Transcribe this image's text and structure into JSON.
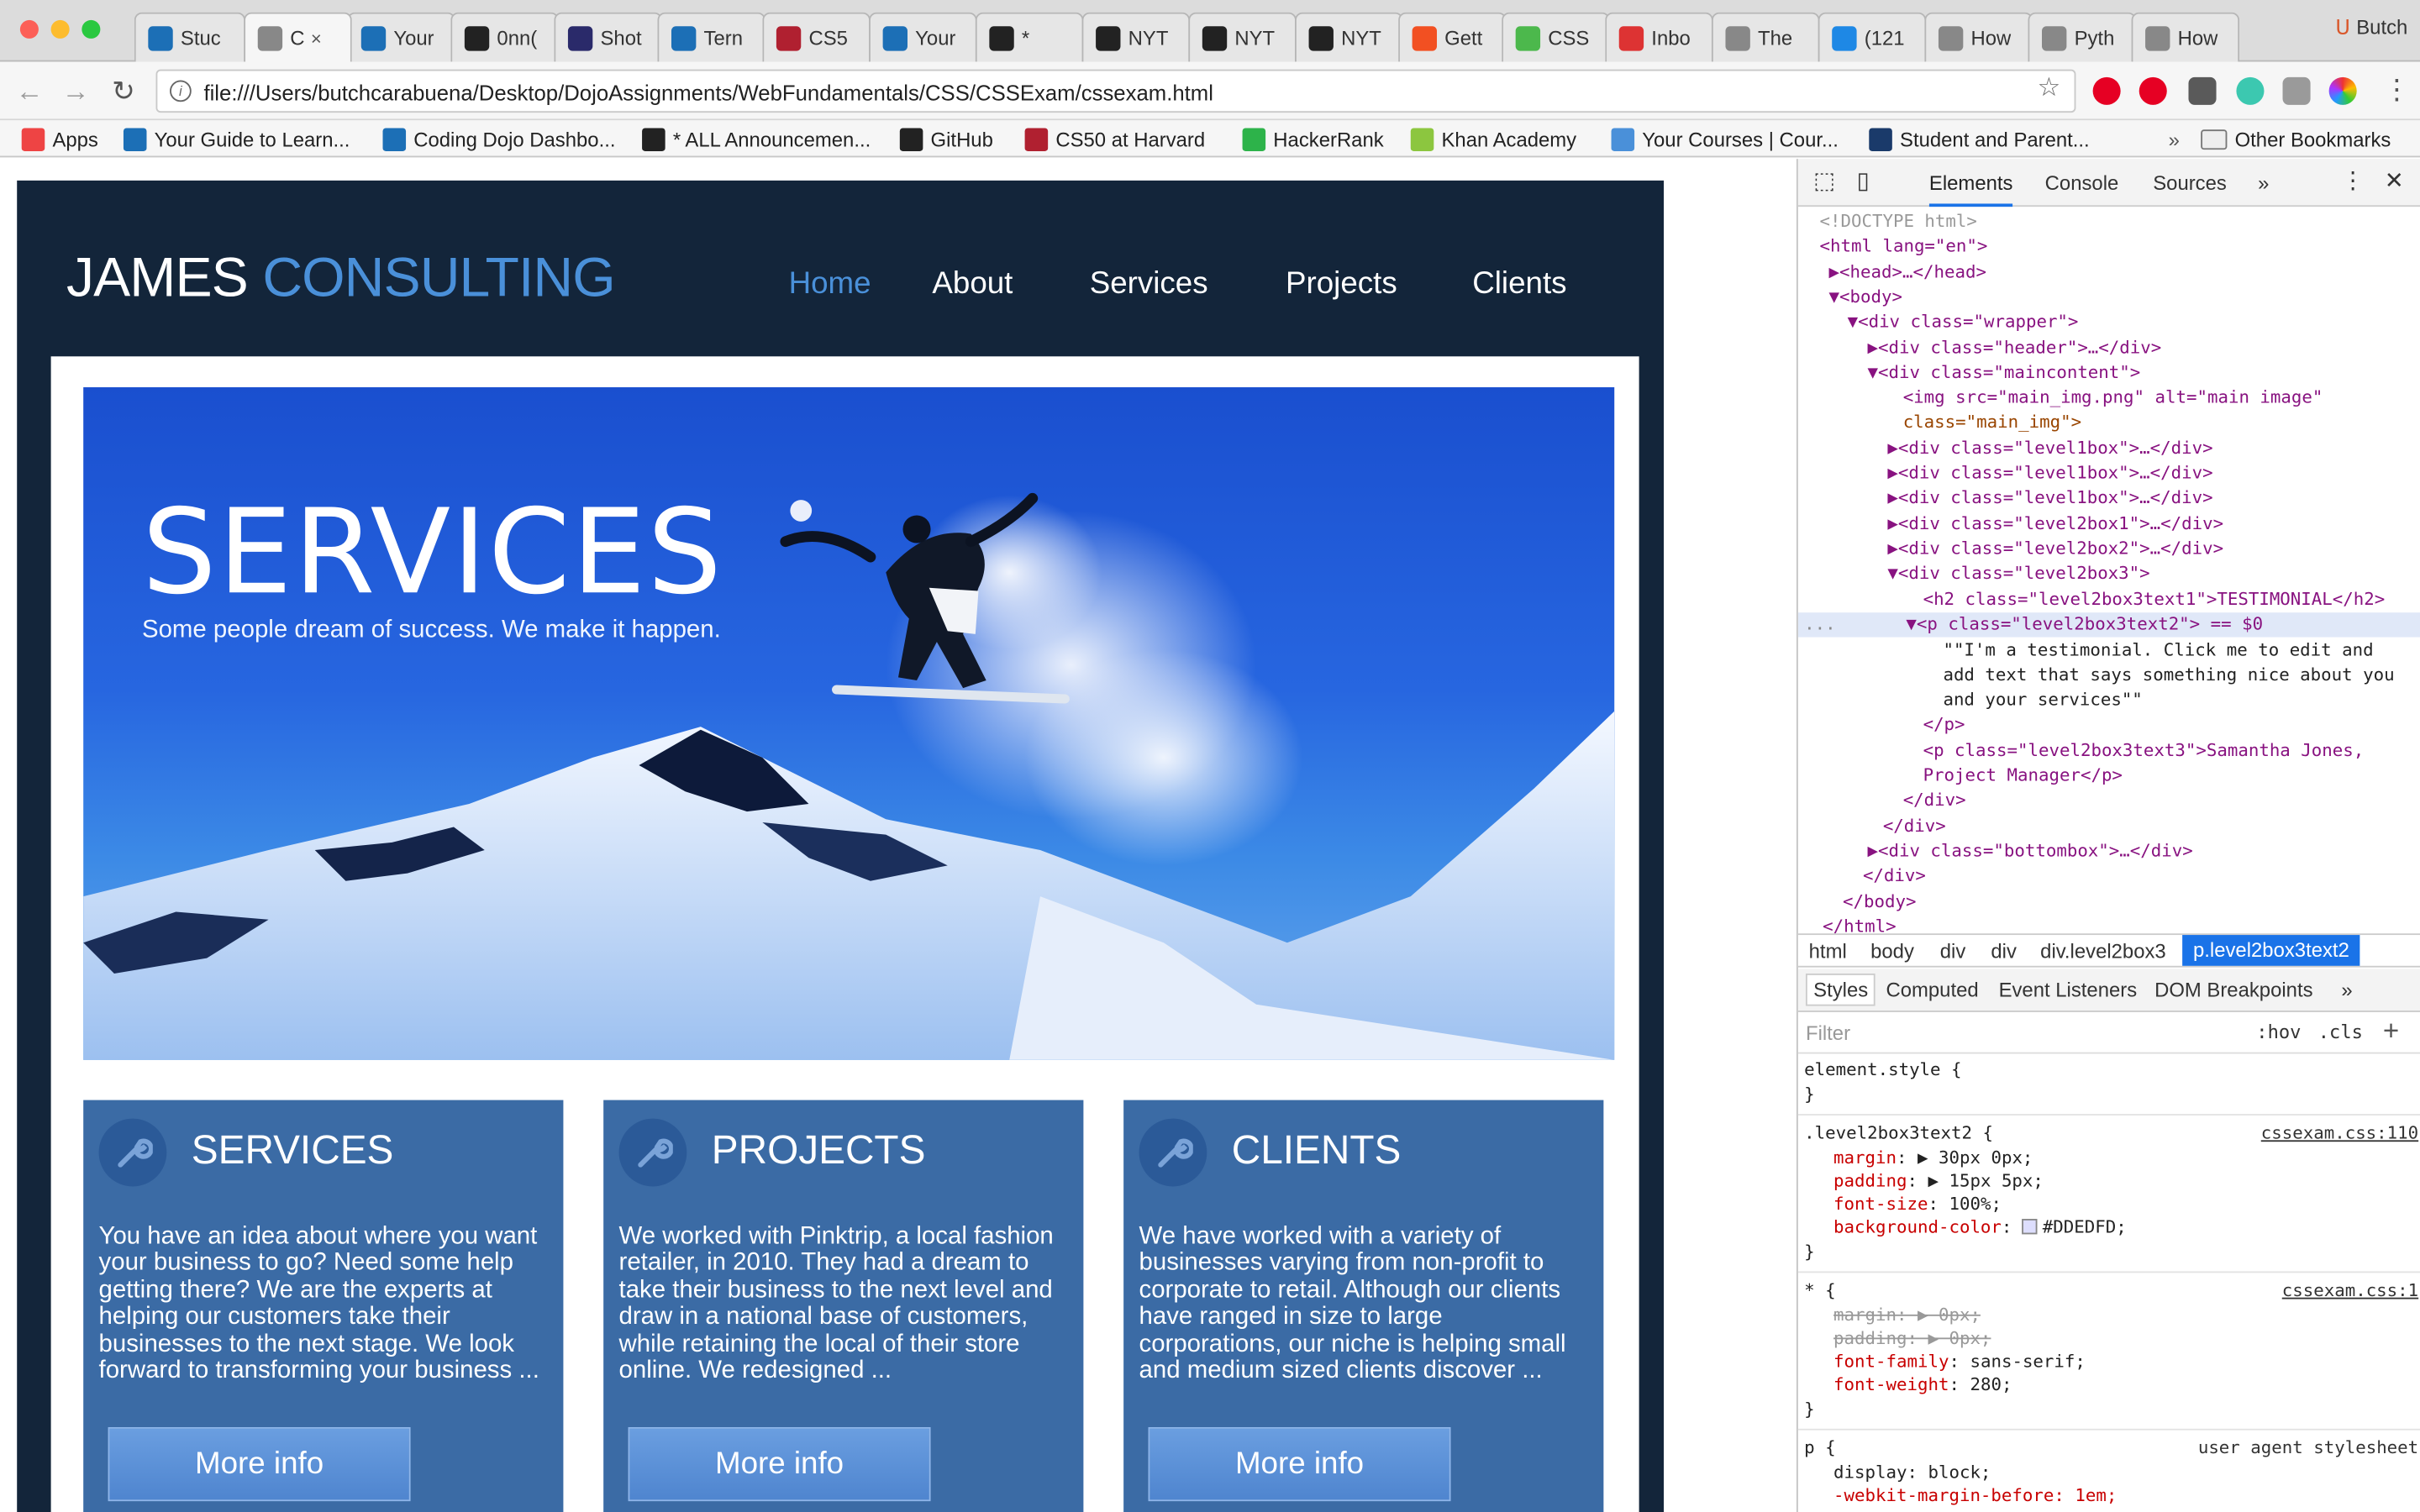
{
  "browser": {
    "tabs": [
      {
        "label": "Stuc"
      },
      {
        "label": "C"
      },
      {
        "label": "Your"
      },
      {
        "label": "0nn("
      },
      {
        "label": "Shot"
      },
      {
        "label": "Tern"
      },
      {
        "label": "CS5"
      },
      {
        "label": "Your"
      },
      {
        "label": "*"
      },
      {
        "label": "NYT"
      },
      {
        "label": "NYT"
      },
      {
        "label": "NYT"
      },
      {
        "label": "Gett"
      },
      {
        "label": "CSS"
      },
      {
        "label": "Inbo"
      },
      {
        "label": "The"
      },
      {
        "label": "(121"
      },
      {
        "label": "How"
      },
      {
        "label": "Pyth"
      },
      {
        "label": "How"
      }
    ],
    "close_glyph": "×",
    "profile_name": "Butch",
    "url": "file:///Users/butchcarabuena/Desktop/DojoAssignments/WebFundamentals/CSS/CSSExam/cssexam.html",
    "bookmarks": [
      {
        "label": "Apps"
      },
      {
        "label": "Your Guide to Learn..."
      },
      {
        "label": "Coding Dojo Dashbo..."
      },
      {
        "label": "* ALL Announcemen..."
      },
      {
        "label": "GitHub"
      },
      {
        "label": "CS50 at Harvard"
      },
      {
        "label": "HackerRank"
      },
      {
        "label": "Khan Academy"
      },
      {
        "label": "Your Courses | Cour..."
      },
      {
        "label": "Student and Parent..."
      }
    ],
    "bookmarks_more": "»",
    "other_bookmarks": "Other Bookmarks"
  },
  "site": {
    "logo_first": "JAMES",
    "logo_second": "CONSULTING",
    "nav": [
      "Home",
      "About",
      "Services",
      "Projects",
      "Clients"
    ],
    "hero_title": "SERVICES",
    "hero_subtitle": "Some people dream of success. We make it happen.",
    "cards": [
      {
        "title": "SERVICES",
        "text": "You have an idea about where you want your business to go? Need some help getting there? We are the experts at helping our customers take their businesses to the next stage. We look forward to transforming your business ...",
        "button": "More info"
      },
      {
        "title": "PROJECTS",
        "text": "We worked with Pinktrip, a local fashion retailer, in 2010. They had a dream to take their business to the next level and draw in a national base of customers, while retaining the local of their store online. We redesigned ...",
        "button": "More info"
      },
      {
        "title": "CLIENTS",
        "text": "We have worked with a variety of businesses varying from non-profit to corporate to retail. Although our clients have ranged in size to large corporations, our niche is helping small and medium sized clients discover ...",
        "button": "More info"
      }
    ]
  },
  "devtools": {
    "tabs": [
      "Elements",
      "Console",
      "Sources"
    ],
    "more_tabs": "»",
    "dom": {
      "doctype": "<!DOCTYPE html>",
      "html_open": "<html lang=\"en\">",
      "head": "<head>…</head>",
      "body_open": "<body>",
      "wrapper": "<div class=\"wrapper\">",
      "header": "<div class=\"header\">…</div>",
      "maincontent": "<div class=\"maincontent\">",
      "img_line1": "<img src=\"main_img.png\" alt=\"main image\"",
      "img_line2": "class=\"main_img\">",
      "level1box_a": "<div class=\"level1box\">…</div>",
      "level1box_b": "<div class=\"level1box\">…</div>",
      "level1box_c": "<div class=\"level1box\">…</div>",
      "level2box1": "<div class=\"level2box1\">…</div>",
      "level2box2": "<div class=\"level2box2\">…</div>",
      "level2box3": "<div class=\"level2box3\">",
      "h2_line": "<h2 class=\"level2box3text1\">TESTIMONIAL</h2>",
      "p_selected": "<p class=\"level2box3text2\"> == $0",
      "ellipsis": "...",
      "text_line1": "\"\"I'm a testimonial. Click me to edit and",
      "text_line2": "add text that says something nice about you",
      "text_line3": "and your services\"\"",
      "p_close": "</p>",
      "p3_line1": "<p class=\"level2box3text3\">Samantha Jones,",
      "p3_line2": "Project Manager</p>",
      "div_close_1": "</div>",
      "div_close_2": "</div>",
      "bottombox": "<div class=\"bottombox\">…</div>",
      "div_close_3": "</div>",
      "body_close": "</body>",
      "html_close": "</html>"
    },
    "breadcrumbs": [
      "html",
      "body",
      "div",
      "div",
      "div.level2box3",
      "p.level2box3text2"
    ],
    "style_tabs": [
      "Styles",
      "Computed",
      "Event Listeners",
      "DOM Breakpoints"
    ],
    "style_tabs_more": "»",
    "filter_placeholder": "Filter",
    "hov": ":hov",
    "cls": ".cls",
    "plus": "+",
    "rules": {
      "element_style": "element.style {",
      "close": "}",
      "r1_selector": ".level2box3text2 {",
      "r1_source": "cssexam.css:110",
      "r1_margin_prop": "margin",
      "r1_margin_val": "30px 0px;",
      "r1_padding_prop": "padding",
      "r1_padding_val": "15px 5px;",
      "r1_fontsize_prop": "font-size",
      "r1_fontsize_val": "100%;",
      "r1_bg_prop": "background-color",
      "r1_bg_val": "#DDEDFD;",
      "r2_selector": "* {",
      "r2_source": "cssexam.css:1",
      "r2_margin": "margin: ▶ 0px;",
      "r2_padding": "padding: ▶ 0px;",
      "r2_ff_prop": "font-family",
      "r2_ff_val": "sans-serif;",
      "r2_fw_prop": "font-weight",
      "r2_fw_val": "280;",
      "r3_selector": "p {",
      "r3_source": "user agent stylesheet",
      "r3_display": "display: block;",
      "r3_margin_before": "-webkit-margin-before: 1em;"
    }
  }
}
